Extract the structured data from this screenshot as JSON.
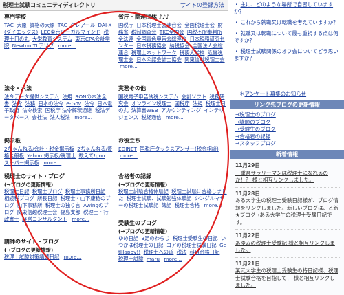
{
  "header": {
    "title": "税理士試験コミュニティディレクトリ",
    "register_link": "サイトの登録方法"
  },
  "categories": [
    {
      "key": "school",
      "title": "専門学校",
      "items": [
        "TAC",
        "大原",
        "資格の大原",
        "TAC",
        "クレアール",
        "DAI-X(ダイエックス)",
        "LEC東京リーガルマインド",
        "税理士日の丸",
        "大栄教育システム",
        "東京CPA会計学院",
        "Newton TLアソブ"
      ],
      "more": "more..."
    },
    {
      "key": "govt",
      "title": "省庁・関連団体",
      "items": [
        "国税庁",
        "日本税理士会連合会",
        "全国税理士会",
        "財務省",
        "税制調査会",
        "TKC全国会",
        "国税不服審判所",
        "全法連",
        "全国青色申告会総連合",
        "日本税務研究センター",
        "日本税務協会",
        "納税協会",
        "全国法人会総連合",
        "税理士ネットワーク",
        "税務大学校",
        "近畿税理士会",
        "日本公認会計士協会",
        "関東信越税理士会"
      ],
      "more": "more..."
    },
    {
      "key": "law",
      "title": "法令・六法",
      "items": [
        "法令データ提供システム",
        "法規",
        "RONの六法全書",
        "法令",
        "法務",
        "日本の法令",
        "e-Gov",
        "法令",
        "日本電子政府",
        "法令検索",
        "国税庁 法令解釈通達",
        "税法データベース",
        "会社法",
        "法人税法"
      ],
      "more": "more..."
    },
    {
      "key": "affairs",
      "title": "実務その他",
      "items": [
        "国税電子申告納税システム",
        "会計ソフト",
        "税務研究会",
        "オンライン税理士",
        "国税庁",
        "法規",
        "税理士日の丸",
        "決算書WEB",
        "アカウンティング",
        "インテリジェンス",
        "税経通信"
      ],
      "more": "more..."
    },
    {
      "key": "board",
      "title": "掲示板",
      "items": [
        "2ちゃんねる/会計・税金掲示板",
        "2ちゃんねる/資格全般板",
        "Yahoo!掲示板/税理士",
        "教えて!goo",
        "スーパー掲示板"
      ],
      "more": "more..."
    },
    {
      "key": "useful",
      "title": "お役立ち",
      "items": [
        "EDINET",
        "国税庁タックスアンサー(税金相談)"
      ],
      "more": "more..."
    },
    {
      "key": "lecturer",
      "title": "講師のサイト・ブログ",
      "items": [
        "税理士試験対策講師日記"
      ],
      "more": "more..."
    }
  ],
  "blog_sections": [
    {
      "key": "licensee",
      "title": "税理士のサイト・ブログ",
      "sub": "(→ブログの更新情報)",
      "items": [
        "税理士日記",
        "税理士ブログ",
        "税理士事務所日記",
        "相続税ブログ",
        "所長日記",
        "税理士・山下康稔のブログ",
        "山下事務所",
        "税理士の独り言",
        "Awingのブログ",
        "関東信越税理士会",
        "福島支部",
        "税理士・行政書士",
        "経営コンサルタント"
      ],
      "more": "more..."
    },
    {
      "key": "passer",
      "title": "合格者の記録",
      "sub": "(→ブログの更新情報)",
      "items": [
        "税理士試験合格体験記",
        "税理士試験に合格しました",
        "税理士試験、試験勉強体験記",
        "シングルマザーの税理士試験記",
        "簿記",
        "税理士合格"
      ],
      "more": "more..."
    },
    {
      "key": "student",
      "title": "受験生のブログ",
      "sub": "(→ブログの更新情報)",
      "items": [
        "ゆめ日記",
        "3足のわらじ",
        "税理士受験生の日記",
        "いつかは税理士の日記",
        "コアの税理士試験日記",
        "GetHappy!!",
        "税理士への道",
        "税法",
        "科目合格日記",
        "税理士試験",
        "maru"
      ],
      "more": "more..."
    }
  ],
  "sidebar": {
    "questions": [
      "主に、どのような場所で自習していますか？",
      "これから就職又は転職を考えていますか？",
      "就職又は転職について最も重視する点は何ですか？",
      "税理士試験関係のオフ会についてどう思いますか？"
    ],
    "survey_link": "アンケート募集のお知らせ",
    "update_box_title": "リンク先ブログの更新情報",
    "update_links": [
      "→税理士のブログ",
      "→講師のブログ",
      "→受験生のブログ",
      "→合格者の記録",
      "→スタッフブログ"
    ],
    "news_box_title": "新着情報",
    "news": [
      {
        "date": "11月29日",
        "text": "三重県サラリーマンは税理士になれるのか！？ 様と相互リンクしました。"
      },
      {
        "date": "11月28日",
        "text": "ある大学生の税理士受験日記様が、ブログ情報をリンクしました。新しいブログは、と新★ブログ→ある大学生の税理士受験日記です。"
      },
      {
        "date": "11月22日",
        "text": "あゆみの税理士受験記 様と相互リンクしました。"
      },
      {
        "date": "11月21日",
        "text": "某元大学生の税理士受験生の特日記様、税理士試験合格を目指して！ 様と相互リンクしました。"
      }
    ]
  }
}
